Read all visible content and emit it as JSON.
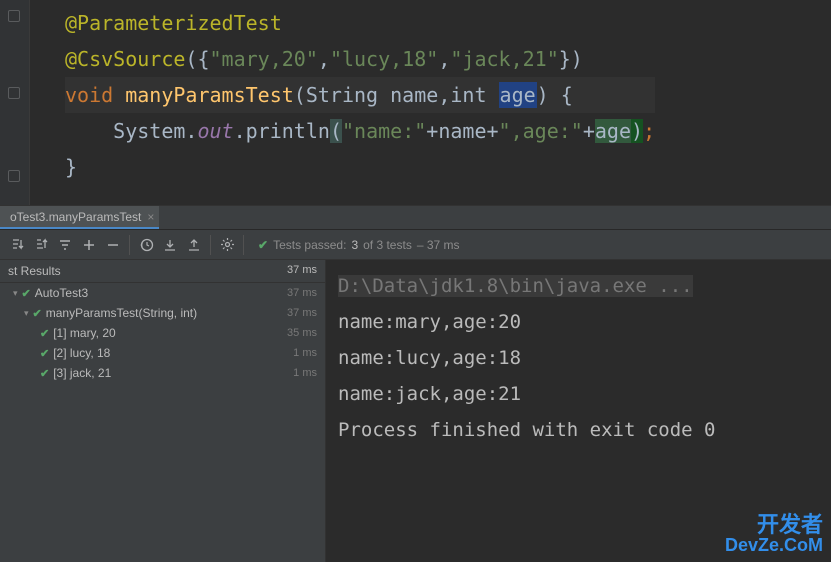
{
  "code": {
    "annotation1": "@ParameterizedTest",
    "annotation2_name": "@CsvSource",
    "annotation2_open": "({",
    "csv_val1": "\"mary,20\"",
    "csv_sep1": ",",
    "csv_val2": "\"lucy,18\"",
    "csv_sep2": ",",
    "csv_val3": "\"jack,21\"",
    "annotation2_close": "})",
    "void": "void ",
    "method_name": "manyParamsTest",
    "method_open": "(",
    "param1_type": "String ",
    "param1_name": "name",
    "param_sep": ",",
    "param2_type": "int ",
    "param2_name": "age",
    "method_close": ") {",
    "system": "System",
    "dot1": ".",
    "out": "out",
    "dot2": ".",
    "println": "println",
    "println_open": "(",
    "str1": "\"name:\"",
    "plus1": "+",
    "var1": "name",
    "plus2": "+",
    "str2": "\",age:\"",
    "plus3": "+",
    "var2": "age",
    "println_close": ")",
    "semi": ";",
    "brace_close": "}"
  },
  "tab": {
    "label": "oTest3.manyParamsTest",
    "close": "×"
  },
  "toolbar": {
    "status_prefix": "Tests passed:",
    "status_count": "3",
    "status_of": "of 3 tests",
    "status_time": "– 37 ms"
  },
  "tree": {
    "header_label": "st Results",
    "header_time": "37 ms",
    "rows": [
      {
        "label": "AutoTest3",
        "time": "37 ms",
        "indent": 1
      },
      {
        "label": "manyParamsTest(String, int)",
        "time": "37 ms",
        "indent": 2
      },
      {
        "label": "[1] mary, 20",
        "time": "35 ms",
        "indent": 3
      },
      {
        "label": "[2] lucy, 18",
        "time": "1 ms",
        "indent": 3
      },
      {
        "label": "[3] jack, 21",
        "time": "1 ms",
        "indent": 3
      }
    ]
  },
  "console": {
    "cmd": "D:\\Data\\jdk1.8\\bin\\java.exe ...",
    "lines": [
      "name:mary,age:20",
      "name:lucy,age:18",
      "name:jack,age:21",
      "",
      "Process finished with exit code 0"
    ]
  },
  "watermark": {
    "cn": "开发者",
    "en": "DevZe.CoM"
  }
}
